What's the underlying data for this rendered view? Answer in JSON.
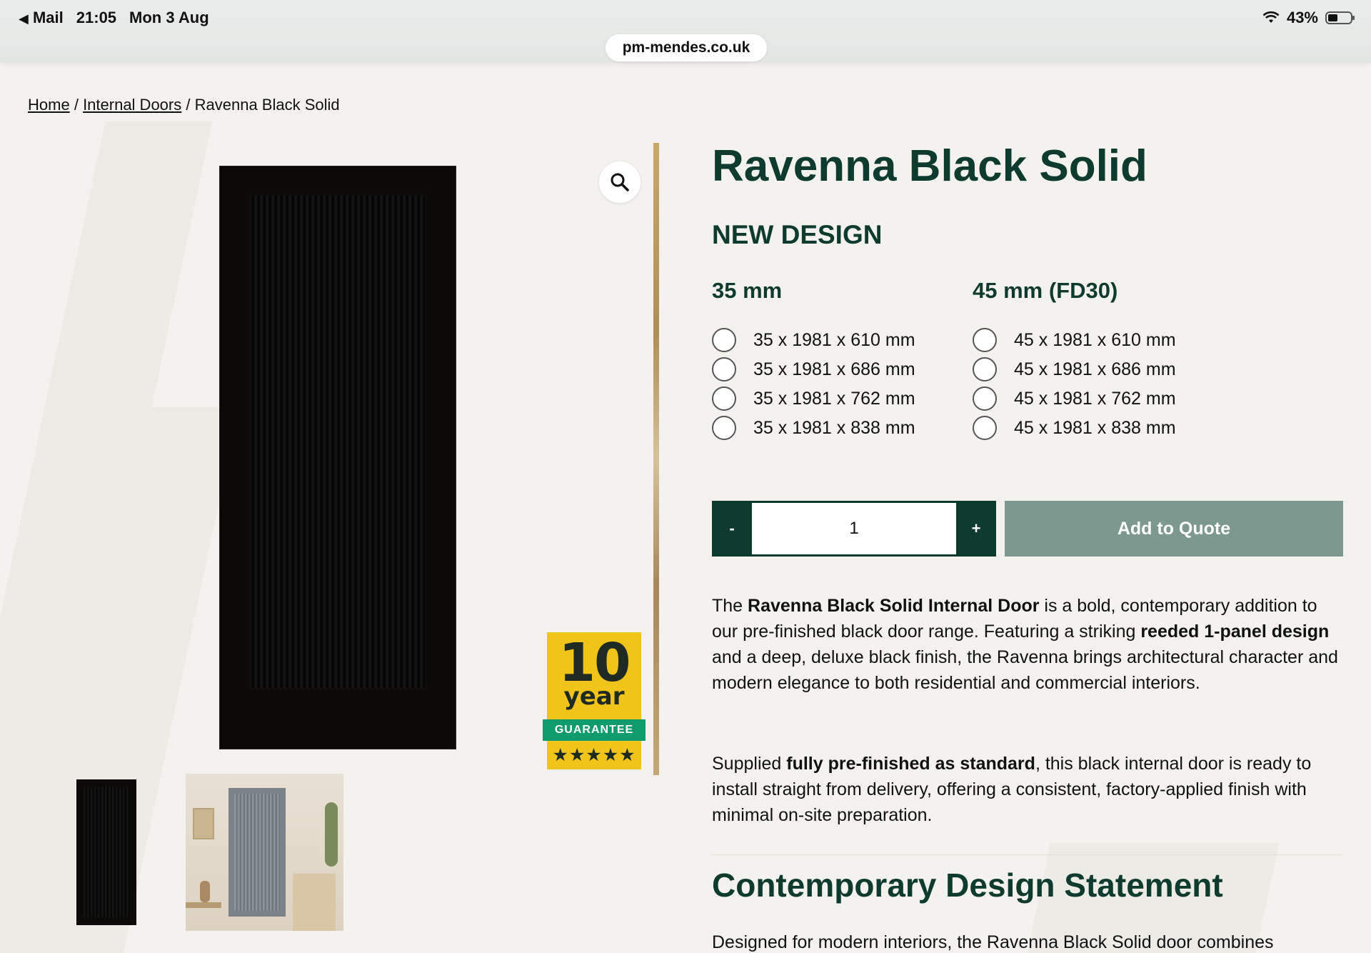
{
  "status_bar": {
    "back_app": "Mail",
    "time": "21:05",
    "date": "Mon 3 Aug",
    "battery_percent": "43%",
    "battery_level": 0.43
  },
  "browser": {
    "url": "pm-mendes.co.uk"
  },
  "breadcrumb": {
    "home": "Home",
    "sep1": "/",
    "category": "Internal Doors",
    "sep2": "/",
    "current": "Ravenna Black Solid"
  },
  "gallery": {
    "zoom_icon": "magnifier-icon",
    "guarantee": {
      "number": "10",
      "word": "year",
      "band": "GUARANTEE",
      "stars": "★★★★★",
      "rating": 5
    }
  },
  "product": {
    "title": "Ravenna Black Solid",
    "subtitle": "NEW DESIGN",
    "col_35": {
      "heading": "35 mm",
      "options": [
        "35 x 1981 x 610 mm",
        "35 x 1981 x 686 mm",
        "35 x 1981 x 762 mm",
        "35 x 1981 x 838 mm"
      ]
    },
    "col_45": {
      "heading": "45 mm (FD30)",
      "options": [
        "45 x 1981 x 610 mm",
        "45 x 1981 x 686 mm",
        "45 x 1981 x 762 mm",
        "45 x 1981 x 838 mm"
      ]
    },
    "quantity": {
      "minus": "-",
      "value": "1",
      "plus": "+"
    },
    "add_to_quote": "Add to Quote",
    "colors": {
      "primary": "#0e3b2e",
      "button_muted": "#7d988e",
      "gold": "#f0c419",
      "green_band": "#0f9b6b"
    }
  },
  "description": {
    "p1": {
      "t1": "The ",
      "b1": "Ravenna Black Solid Internal Door",
      "t2": " is a bold, contemporary addition to our pre-finished black door range. Featuring a striking ",
      "b2": "reeded 1-panel design",
      "t3": " and a deep, deluxe black finish, the Ravenna brings architectural character and modern elegance to both residential and commercial interiors."
    },
    "p2": {
      "t1": "Supplied ",
      "b1": "fully pre-finished as standard",
      "t2": ", this black internal door is ready to install straight from delivery, offering a consistent, factory-applied finish with minimal on-site preparation."
    },
    "heading2": "Contemporary Design Statement",
    "p3": "Designed for modern interiors, the Ravenna Black Solid door combines"
  }
}
